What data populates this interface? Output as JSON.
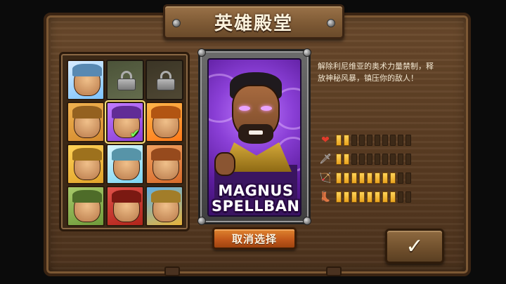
{
  "screen": {
    "title": "英雄殿堂"
  },
  "roster": {
    "portraits": [
      {
        "id": "knight",
        "locked": false,
        "selected": false,
        "colors": [
          "#7dc4ff",
          "#d8ecff"
        ]
      },
      {
        "id": "locked-2",
        "locked": true,
        "selected": false,
        "colors": [
          "#7a8a4a",
          "#5b6b34"
        ]
      },
      {
        "id": "locked-3",
        "locked": true,
        "selected": false,
        "colors": [
          "#6a5a30",
          "#4f4222"
        ]
      },
      {
        "id": "dwarf",
        "locked": false,
        "selected": false,
        "colors": [
          "#d48a2e",
          "#f0b250"
        ]
      },
      {
        "id": "magnus",
        "locked": false,
        "selected": true,
        "colors": [
          "#8a3fd6",
          "#c07bff"
        ]
      },
      {
        "id": "fire-elemental",
        "locked": false,
        "selected": false,
        "colors": [
          "#ff7a1a",
          "#ffb54a"
        ]
      },
      {
        "id": "king",
        "locked": false,
        "selected": false,
        "colors": [
          "#e0a22a",
          "#ffd257"
        ]
      },
      {
        "id": "frost",
        "locked": false,
        "selected": false,
        "colors": [
          "#7cd4f0",
          "#d8f6ff"
        ]
      },
      {
        "id": "viking",
        "locked": false,
        "selected": false,
        "colors": [
          "#d66a2a",
          "#f0a060"
        ]
      },
      {
        "id": "orc",
        "locked": false,
        "selected": false,
        "colors": [
          "#6f9a3a",
          "#a7c96a"
        ]
      },
      {
        "id": "samurai",
        "locked": false,
        "selected": false,
        "colors": [
          "#b0241a",
          "#e0524a"
        ]
      },
      {
        "id": "sea-king",
        "locked": false,
        "selected": false,
        "colors": [
          "#e7b33a",
          "#5fb0e8"
        ]
      }
    ]
  },
  "hero": {
    "name_line1": "MAGNUS",
    "name_line2": "SPELLBANE",
    "description": "解除利尼维亚的奥术力量禁制，释放神秘风暴，镇压你的敌人！",
    "stats": [
      {
        "icon": "heart-icon",
        "glyph": "❤",
        "color": "#e23a2a",
        "value": 2,
        "max": 10
      },
      {
        "icon": "sword-icon",
        "glyph": "🗡",
        "color": "#cfd6e0",
        "value": 2,
        "max": 10
      },
      {
        "icon": "bow-icon",
        "glyph": "🏹",
        "color": "#c9a36a",
        "value": 8,
        "max": 10
      },
      {
        "icon": "boots-icon",
        "glyph": "👢",
        "color": "#c9a36a",
        "value": 8,
        "max": 10
      }
    ]
  },
  "actions": {
    "deselect_label": "取消选择",
    "confirm_glyph": "✓"
  }
}
